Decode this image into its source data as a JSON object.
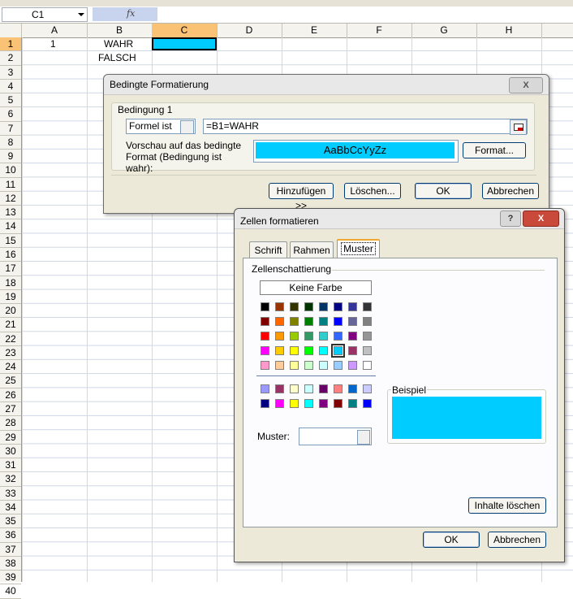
{
  "formula_bar": {
    "name_box": "C1",
    "fx_label": "fx",
    "formula": ""
  },
  "columns": [
    "A",
    "B",
    "C",
    "D",
    "E",
    "F",
    "G",
    "H"
  ],
  "selected_column": "C",
  "rows": [
    "1",
    "2",
    "3",
    "4",
    "5",
    "6",
    "7",
    "8",
    "9",
    "10",
    "11",
    "12",
    "13",
    "14",
    "15",
    "16",
    "17",
    "18",
    "19",
    "20",
    "21",
    "22",
    "23",
    "24",
    "25",
    "26",
    "27",
    "28",
    "29",
    "30",
    "31",
    "32",
    "33",
    "34",
    "35",
    "36",
    "37",
    "38",
    "39",
    "40"
  ],
  "cells": {
    "a1": "1",
    "b1": "WAHR",
    "b2": "FALSCH",
    "c1_color": "#00ccff"
  },
  "bedingte": {
    "title": "Bedingte Formatierung",
    "help_btn": "?",
    "close_btn": "X",
    "group_label": "Bedingung 1",
    "condition_type": "Formel ist",
    "formula": "=B1=WAHR",
    "preview_label": "Vorschau auf das bedingte Format (Bedingung ist wahr):",
    "preview_text": "AaBbCcYyZz",
    "preview_color": "#00ccff",
    "format_btn": "Format...",
    "add_btn": "Hinzufügen >>",
    "delete_btn": "Löschen...",
    "ok_btn": "OK",
    "cancel_btn": "Abbrechen"
  },
  "zellen": {
    "title": "Zellen formatieren",
    "help_btn": "?",
    "close_btn": "X",
    "tabs": [
      "Schrift",
      "Rahmen",
      "Muster"
    ],
    "active_tab": "Muster",
    "shading_label": "Zellenschattierung",
    "no_color": "Keine Farbe",
    "palette_main": [
      [
        "#000000",
        "#993300",
        "#333300",
        "#003300",
        "#003366",
        "#000080",
        "#333399",
        "#333333"
      ],
      [
        "#800000",
        "#ff6600",
        "#808000",
        "#008000",
        "#008080",
        "#0000ff",
        "#666699",
        "#808080"
      ],
      [
        "#ff0000",
        "#ff9900",
        "#99cc00",
        "#339966",
        "#33cccc",
        "#3366ff",
        "#800080",
        "#969696"
      ],
      [
        "#ff00ff",
        "#ffcc00",
        "#ffff00",
        "#00ff00",
        "#00ffff",
        "#00ccff",
        "#993366",
        "#c0c0c0"
      ],
      [
        "#ff99cc",
        "#ffcc99",
        "#ffff99",
        "#ccffcc",
        "#ccffff",
        "#99ccff",
        "#cc99ff",
        "#ffffff"
      ]
    ],
    "palette_extra": [
      [
        "#9999ff",
        "#993366",
        "#ffffcc",
        "#ccffff",
        "#660066",
        "#ff8080",
        "#0066cc",
        "#ccccff"
      ],
      [
        "#000080",
        "#ff00ff",
        "#ffff00",
        "#00ffff",
        "#800080",
        "#800000",
        "#008080",
        "#0000ff"
      ]
    ],
    "selected_color": "#00ccff",
    "pattern_label": "Muster:",
    "pattern_value": "",
    "sample_label": "Beispiel",
    "sample_color": "#00ccff",
    "clear_btn": "Inhalte löschen",
    "ok_btn": "OK",
    "cancel_btn": "Abbrechen"
  }
}
